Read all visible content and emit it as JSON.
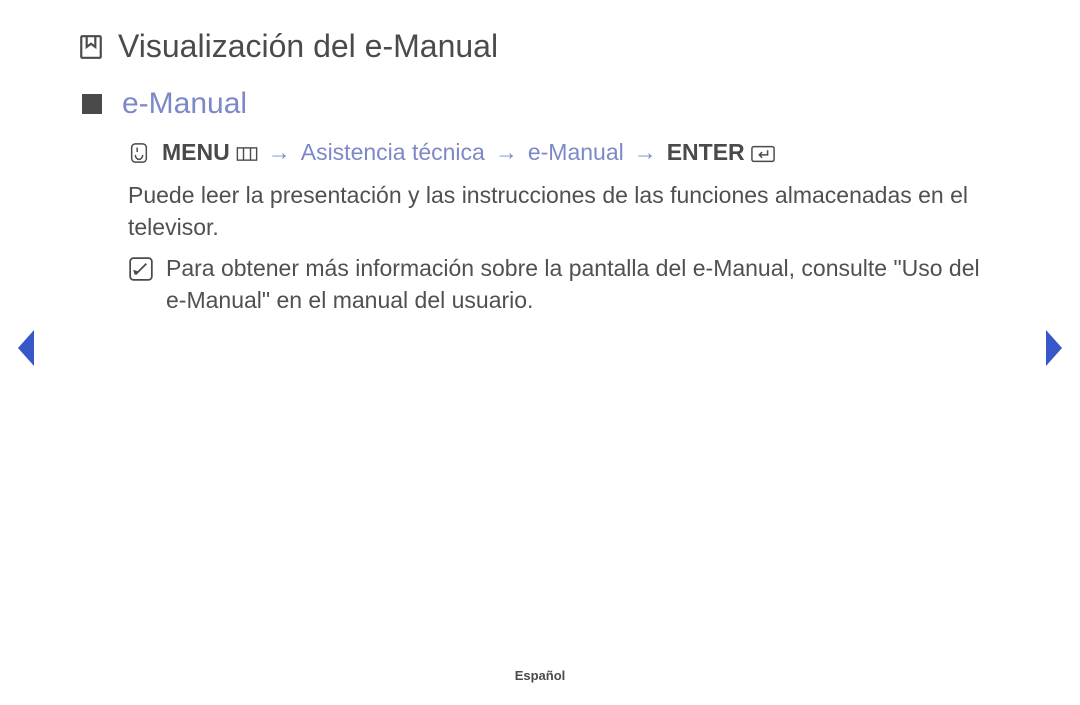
{
  "title": "Visualización del e-Manual",
  "subtitle": "e-Manual",
  "nav": {
    "menu_label": "MENU",
    "arrow": "→",
    "path1": "Asistencia técnica",
    "path2": "e-Manual",
    "enter_label": "ENTER"
  },
  "body": "Puede leer la presentación y las instrucciones de las funciones almacenadas en el televisor.",
  "note": "Para obtener más información sobre la pantalla del e-Manual, consulte \"Uso del e-Manual\" en el manual del usuario.",
  "footer_language": "Español",
  "colors": {
    "accent": "#7d88c9",
    "nav_blue": "#3756c8",
    "text": "#505050"
  }
}
